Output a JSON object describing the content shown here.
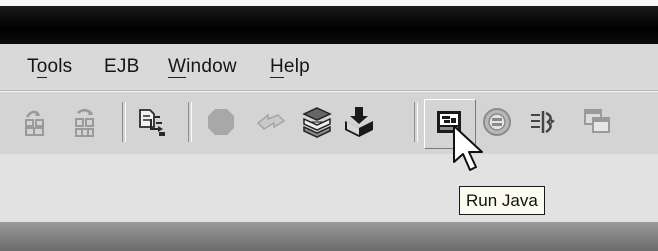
{
  "menubar": {
    "items": [
      {
        "label": "Tools",
        "accel": "o"
      },
      {
        "label": "EJB"
      },
      {
        "label": "Window",
        "accel": "W"
      },
      {
        "label": "Help",
        "accel": "H"
      }
    ]
  },
  "toolbar": {
    "buttons": [
      {
        "icon": "step-over-icon"
      },
      {
        "icon": "step-into-icon"
      },
      {
        "icon": "compile-icon"
      },
      {
        "icon": "stop-icon"
      },
      {
        "icon": "continue-icon"
      },
      {
        "icon": "build-icon"
      },
      {
        "icon": "install-icon"
      },
      {
        "icon": "run-java-icon",
        "state": "pressed"
      },
      {
        "icon": "debug-icon"
      },
      {
        "icon": "trace-icon"
      },
      {
        "icon": "window-icon"
      }
    ]
  },
  "tooltip": {
    "text": "Run Java"
  }
}
